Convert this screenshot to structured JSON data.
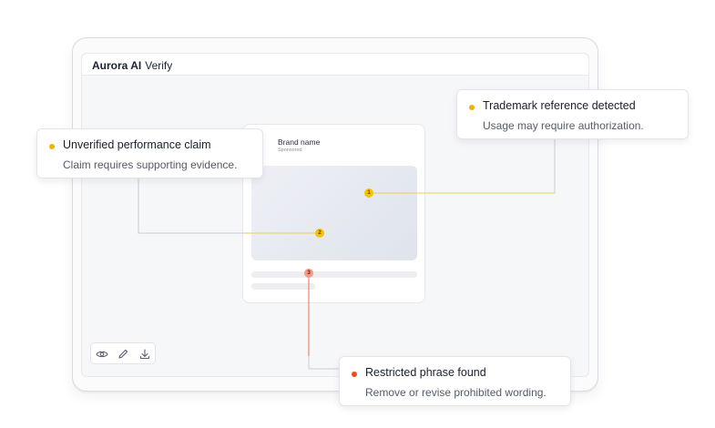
{
  "app": {
    "name": "Aurora AI",
    "module": "Verify"
  },
  "ad_preview": {
    "brand_name": "Brand name",
    "sponsored_label": "Sponsored"
  },
  "markers": [
    {
      "number": "1",
      "color": "#f5c400"
    },
    {
      "number": "2",
      "color": "#f5c400"
    },
    {
      "number": "3",
      "color": "#f59a86"
    }
  ],
  "issues": [
    {
      "title": "Trademark reference detected",
      "description": "Usage may require authorization.",
      "severity_color": "#f0b400"
    },
    {
      "title": "Unverified performance claim",
      "description": "Claim requires supporting evidence.",
      "severity_color": "#f0b400"
    },
    {
      "title": "Restricted phrase found",
      "description": "Remove or revise prohibited wording.",
      "severity_color": "#ef4a1f"
    }
  ],
  "toolbar": {
    "icons": [
      "eye-icon",
      "pencil-icon",
      "download-icon"
    ]
  }
}
